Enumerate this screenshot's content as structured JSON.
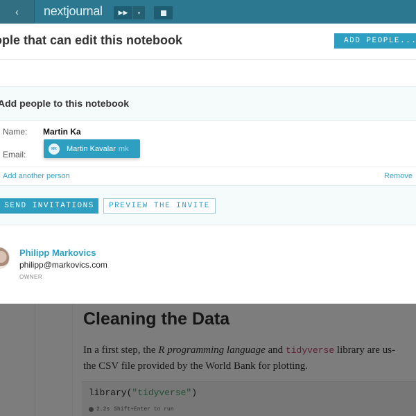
{
  "topbar": {
    "back_icon": "‹",
    "logo": "nextjournal",
    "run_icon": "▶▶",
    "caret_icon": "▾",
    "colors": {
      "bar": "#2c7890"
    }
  },
  "modal": {
    "title": "ople that can edit this notebook",
    "add_people_label": "ADD PEOPLE...",
    "form": {
      "title": "Add people to this notebook",
      "name_label": "Name:",
      "name_value": "Martin Ka",
      "email_label": "Email:",
      "add_another": "Add another person",
      "remove": "Remove",
      "suggestion": {
        "avatar_initials": "MK",
        "name": "Martin Kavalar",
        "initials": "mk"
      },
      "send_label": "SEND INVITATIONS",
      "preview_label": "PREVIEW THE INVITE"
    },
    "owner": {
      "name": "Philipp Markovics",
      "email": "philipp@markovics.com",
      "role": "OWNER"
    }
  },
  "notebook": {
    "heading": "Cleaning the Data",
    "para_1": "In a first step, the ",
    "para_lang": "R programming language",
    "para_2": " and ",
    "para_lib": "tidyverse",
    "para_3": " library are us-",
    "para_line2": "the CSV file provided by the World Bank for plotting.",
    "code_fn": "library(",
    "code_arg": "\"tidyverse\"",
    "code_close": ")",
    "status_time": "2.2s",
    "status_hint": "Shift+Enter to run"
  }
}
